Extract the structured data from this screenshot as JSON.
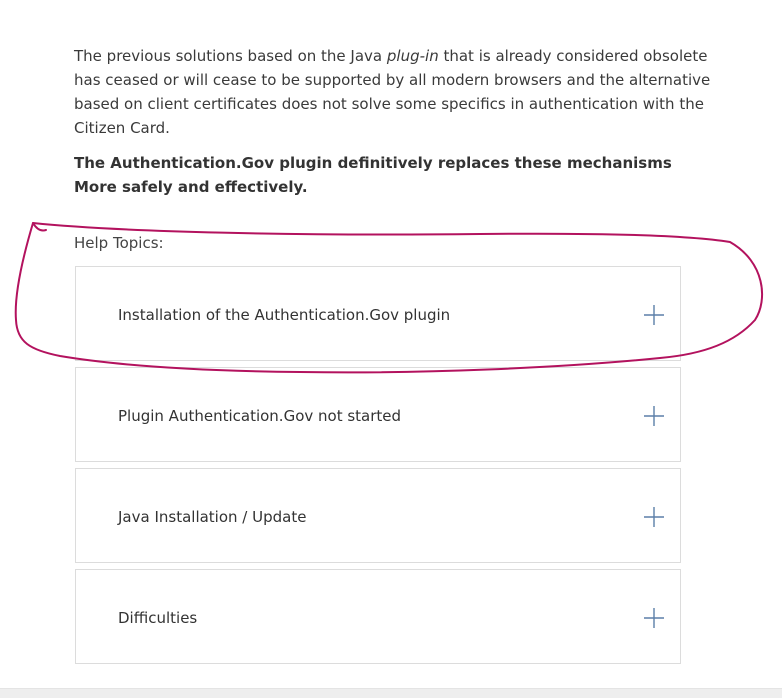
{
  "intro": {
    "part1": "The previous solutions based on the Java ",
    "em": "plug-in",
    "part2": " that is already considered obsolete has ceased or will cease to be supported by all modern browsers and the alternative based on client certificates does not solve some specifics in authentication with the Citizen Card."
  },
  "lead": "The Authentication.Gov plugin definitively replaces these mechanisms More safely and effectively.",
  "help": {
    "title": "Help Topics:",
    "topics": [
      {
        "label": "Installation of the Authentication.Gov plugin"
      },
      {
        "label": "Plugin Authentication.Gov not started"
      },
      {
        "label": "Java Installation / Update"
      },
      {
        "label": "Difficulties"
      }
    ]
  },
  "colors": {
    "plus_icon": "#5b7fa8",
    "annotation": "#b3125e",
    "border": "#dcdcdc"
  },
  "icons": {
    "expand": "plus-icon"
  }
}
